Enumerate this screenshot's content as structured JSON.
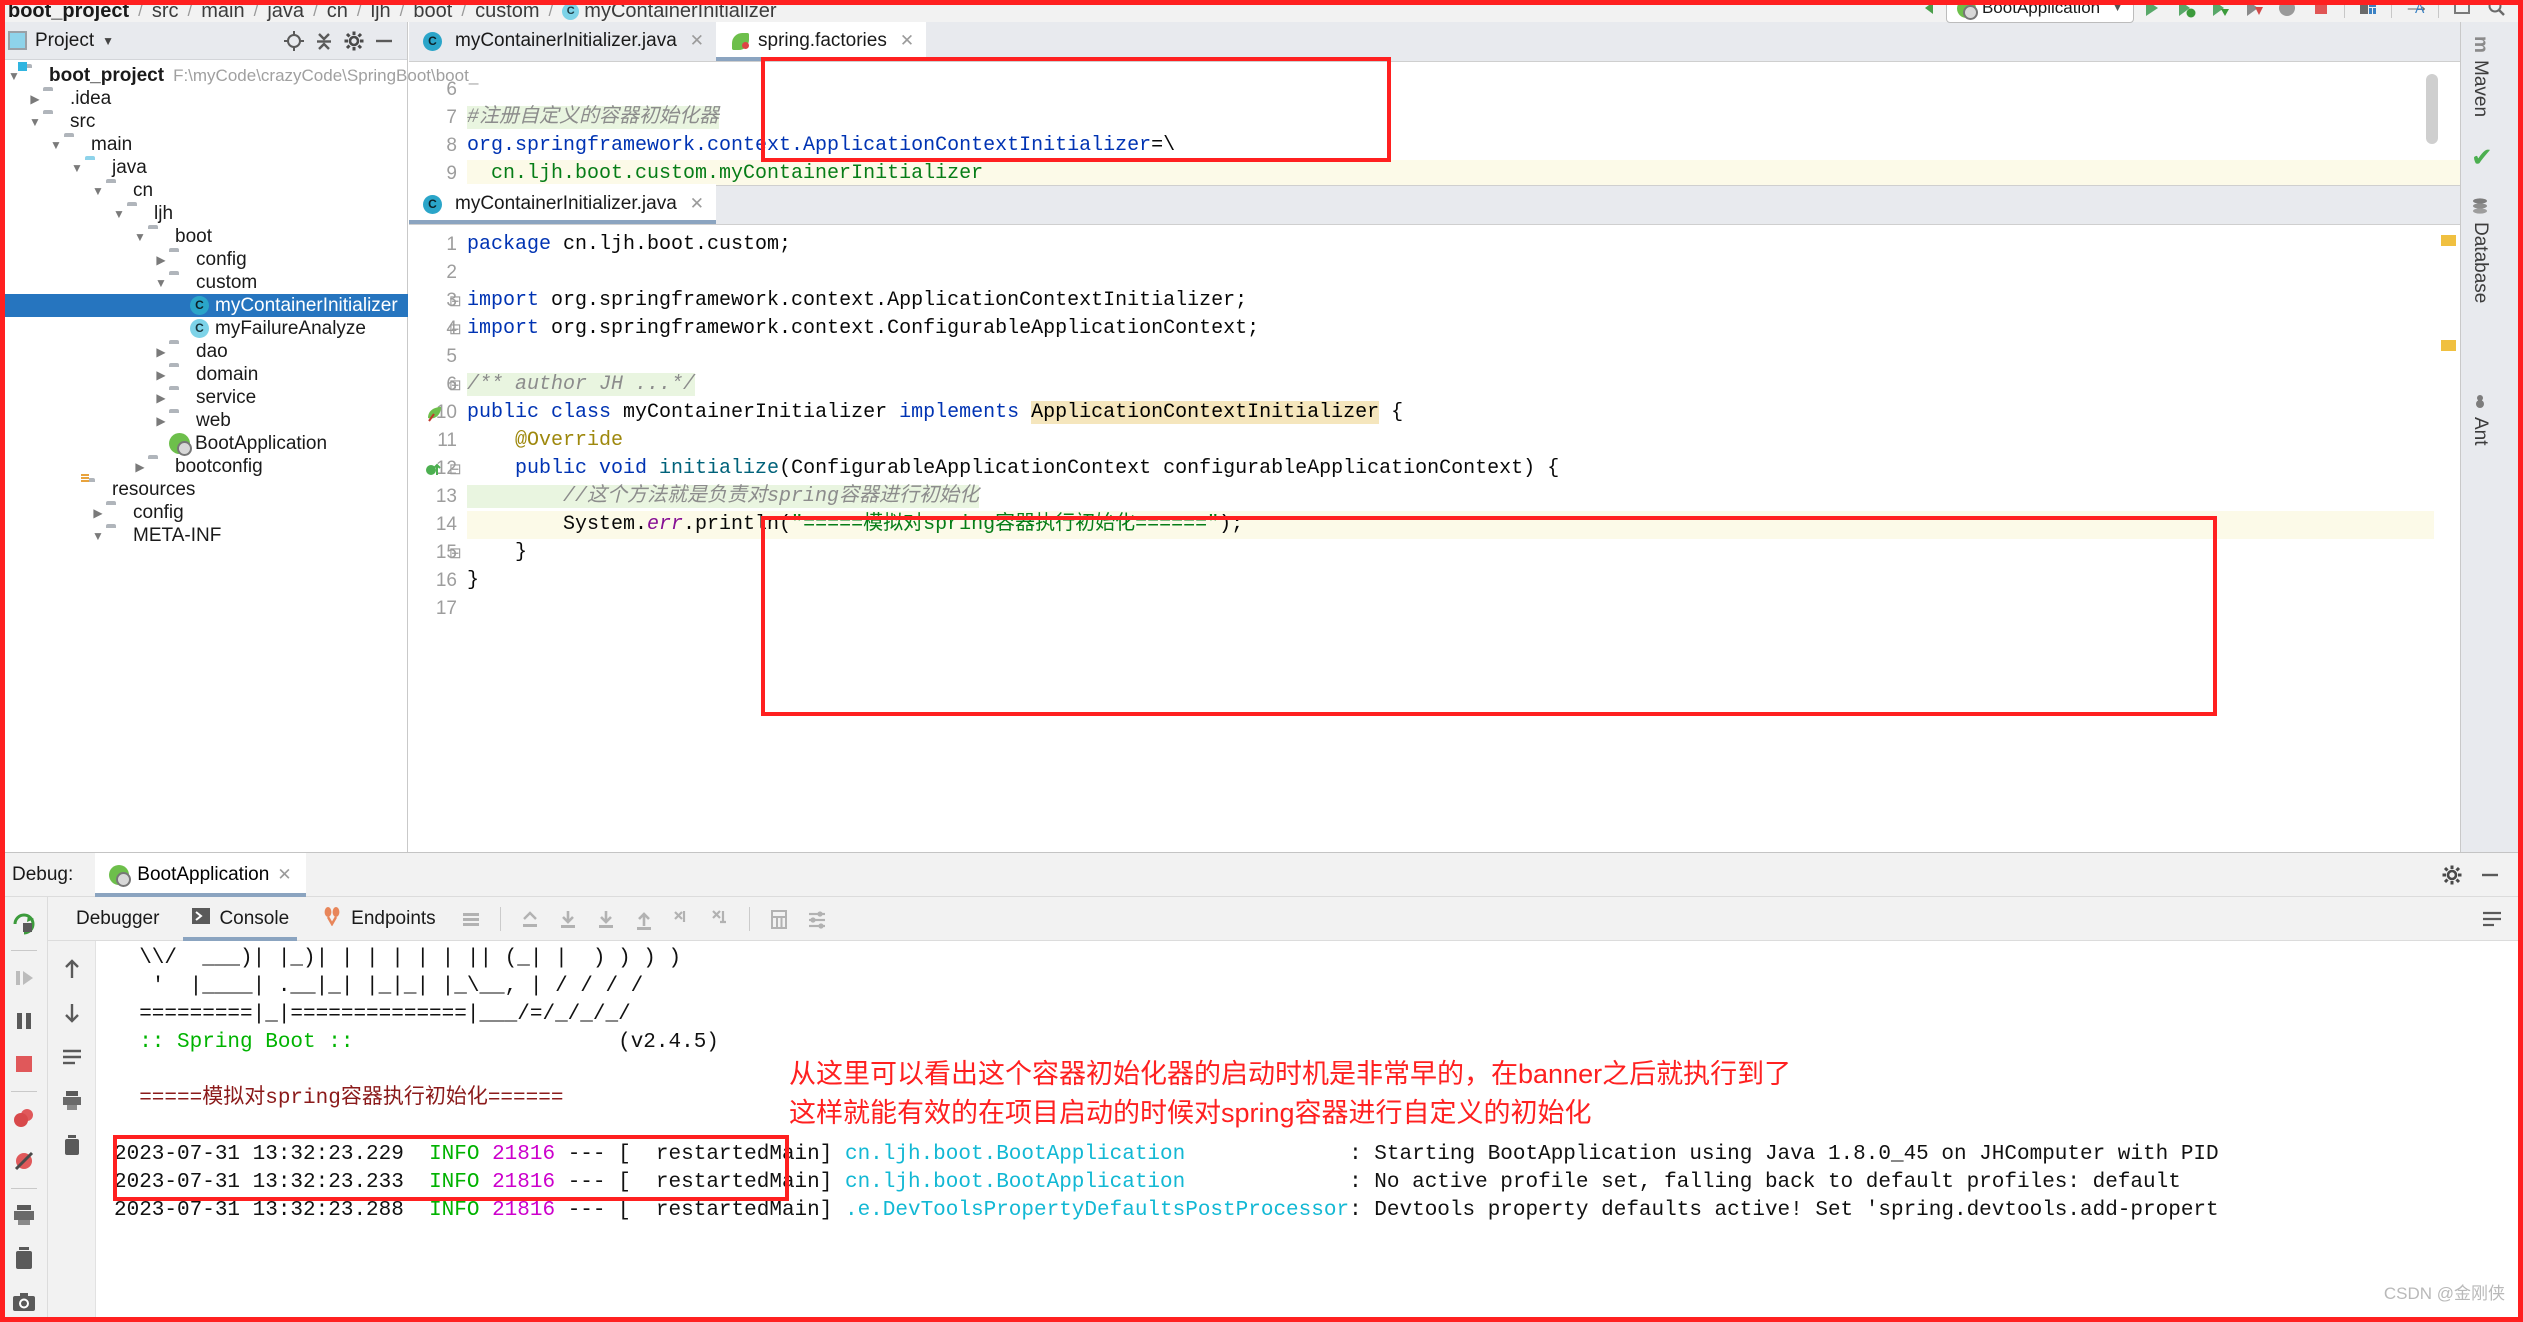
{
  "breadcrumb": {
    "items": [
      "boot_project",
      "src",
      "main",
      "java",
      "cn",
      "ljh",
      "boot",
      "custom",
      "myContainerInitializer"
    ],
    "separator": "/"
  },
  "run_toolbar": {
    "config_name": "BootApplication",
    "icons": [
      "run-icon",
      "debug-icon",
      "run-with-coverage-icon",
      "profile-icon",
      "stop-icon",
      "build-icon",
      "search-everywhere-icon",
      "settings-icon"
    ]
  },
  "project_panel": {
    "title": "Project",
    "header_icons": [
      "locate-icon",
      "collapse-all-icon",
      "settings-gear-icon",
      "hide-icon"
    ],
    "tree": [
      {
        "depth": 0,
        "twisty": "open",
        "icon": "project-folder-icon",
        "label": "boot_project",
        "bold": true,
        "path": "F:\\myCode\\crazyCode\\SpringBoot\\boot_"
      },
      {
        "depth": 1,
        "twisty": "closed",
        "icon": "folder-icon",
        "label": ".idea",
        "bold": false,
        "path": ""
      },
      {
        "depth": 1,
        "twisty": "open",
        "icon": "folder-icon",
        "label": "src",
        "bold": false,
        "path": ""
      },
      {
        "depth": 2,
        "twisty": "open",
        "icon": "folder-icon",
        "label": "main",
        "bold": false,
        "path": ""
      },
      {
        "depth": 3,
        "twisty": "open",
        "icon": "source-folder-icon",
        "label": "java",
        "bold": false,
        "path": ""
      },
      {
        "depth": 4,
        "twisty": "open",
        "icon": "package-icon",
        "label": "cn",
        "bold": false,
        "path": ""
      },
      {
        "depth": 5,
        "twisty": "open",
        "icon": "package-icon",
        "label": "ljh",
        "bold": false,
        "path": ""
      },
      {
        "depth": 6,
        "twisty": "open",
        "icon": "package-icon",
        "label": "boot",
        "bold": false,
        "path": ""
      },
      {
        "depth": 7,
        "twisty": "closed",
        "icon": "package-icon",
        "label": "config",
        "bold": false,
        "path": ""
      },
      {
        "depth": 7,
        "twisty": "open",
        "icon": "package-icon",
        "label": "custom",
        "bold": false,
        "path": ""
      },
      {
        "depth": 8,
        "twisty": "none",
        "icon": "java-class-icon",
        "label": "myContainerInitializer",
        "bold": false,
        "path": "",
        "selected": true
      },
      {
        "depth": 8,
        "twisty": "none",
        "icon": "java-class-icon",
        "label": "myFailureAnalyze",
        "bold": false,
        "path": ""
      },
      {
        "depth": 7,
        "twisty": "closed",
        "icon": "package-icon",
        "label": "dao",
        "bold": false,
        "path": ""
      },
      {
        "depth": 7,
        "twisty": "closed",
        "icon": "package-icon",
        "label": "domain",
        "bold": false,
        "path": ""
      },
      {
        "depth": 7,
        "twisty": "closed",
        "icon": "package-icon",
        "label": "service",
        "bold": false,
        "path": ""
      },
      {
        "depth": 7,
        "twisty": "closed",
        "icon": "package-icon",
        "label": "web",
        "bold": false,
        "path": ""
      },
      {
        "depth": 7,
        "twisty": "none",
        "icon": "spring-boot-class-icon",
        "label": "BootApplication",
        "bold": false,
        "path": ""
      },
      {
        "depth": 6,
        "twisty": "closed",
        "icon": "package-icon",
        "label": "bootconfig",
        "bold": false,
        "path": ""
      },
      {
        "depth": 3,
        "twisty": "none",
        "icon": "resources-folder-icon",
        "label": "resources",
        "bold": false,
        "path": ""
      },
      {
        "depth": 4,
        "twisty": "closed",
        "icon": "folder-icon",
        "label": "config",
        "bold": false,
        "path": ""
      },
      {
        "depth": 4,
        "twisty": "open",
        "icon": "folder-icon",
        "label": "META-INF",
        "bold": false,
        "path": ""
      }
    ]
  },
  "editor_top": {
    "tabs": [
      {
        "label": "myContainerInitializer.java",
        "icon": "java-class-icon",
        "active": false
      },
      {
        "label": "spring.factories",
        "icon": "spring-leaf-icon",
        "active": true
      }
    ],
    "lines": [
      {
        "num": "6",
        "segments": [],
        "current": false
      },
      {
        "num": "7",
        "segments": [
          {
            "t": "#注册自定义的容器初始化器",
            "c": "cmt-hl"
          }
        ],
        "current": false
      },
      {
        "num": "8",
        "segments": [
          {
            "t": "org.springframework.context.ApplicationContextInitializer",
            "c": "propkey"
          },
          {
            "t": "=\\",
            "c": "propsep"
          }
        ],
        "current": false
      },
      {
        "num": "9",
        "segments": [
          {
            "t": "  cn.ljh.boot.custom.myContainerInitializer",
            "c": "propval"
          }
        ],
        "current": true
      }
    ]
  },
  "editor_bottom": {
    "tabs": [
      {
        "label": "myContainerInitializer.java",
        "icon": "java-class-icon",
        "active": true
      }
    ],
    "lines": [
      {
        "num": "1",
        "segments": [
          {
            "t": "package ",
            "c": "kw"
          },
          {
            "t": "cn.ljh.boot.custom;",
            "c": "plain"
          }
        ],
        "current": false,
        "indent": 4
      },
      {
        "num": "2",
        "segments": [],
        "current": false
      },
      {
        "num": "3",
        "segments": [
          {
            "t": "import ",
            "c": "kw"
          },
          {
            "t": "org.springframework.context.ApplicationContextInitializer;",
            "c": "plain"
          }
        ],
        "current": false,
        "fold": "minus"
      },
      {
        "num": "4",
        "segments": [
          {
            "t": "import ",
            "c": "kw"
          },
          {
            "t": "org.springframework.context.ConfigurableApplicationContext;",
            "c": "plain"
          }
        ],
        "current": false,
        "fold": "minus"
      },
      {
        "num": "5",
        "segments": [],
        "current": false
      },
      {
        "num": "6",
        "segments": [
          {
            "t": "/** author JH ...*/",
            "c": "cmt-hl"
          }
        ],
        "current": false,
        "fold": "plus"
      },
      {
        "num": "10",
        "segments": [
          {
            "t": "public class ",
            "c": "kw"
          },
          {
            "t": "myContainerInitializer ",
            "c": "plain"
          },
          {
            "t": "implements ",
            "c": "kw"
          },
          {
            "t": "ApplicationContextInitializer",
            "c": "hlident"
          },
          {
            "t": " {",
            "c": "plain"
          }
        ],
        "current": false,
        "gutter_mark": "spring-bean-icon"
      },
      {
        "num": "11",
        "segments": [
          {
            "t": "    @Override",
            "c": "anno"
          }
        ],
        "current": false
      },
      {
        "num": "12",
        "segments": [
          {
            "t": "    public void ",
            "c": "kw"
          },
          {
            "t": "initialize",
            "c": "fnm"
          },
          {
            "t": "(ConfigurableApplicationContext configurableApplicationContext) {",
            "c": "plain"
          }
        ],
        "current": false,
        "gutter_mark": "override-icon",
        "fold": "minus"
      },
      {
        "num": "13",
        "segments": [
          {
            "t": "        //这个方法就是负责对spring容器进行初始化",
            "c": "cmt-hl"
          }
        ],
        "current": false
      },
      {
        "num": "14",
        "segments": [
          {
            "t": "        System.",
            "c": "plain"
          },
          {
            "t": "err",
            "c": "fld"
          },
          {
            "t": ".println(",
            "c": "plain"
          },
          {
            "t": "\"=====模拟对spring容器执行初始化======\"",
            "c": "str"
          },
          {
            "t": ");",
            "c": "plain"
          }
        ],
        "current": true
      },
      {
        "num": "15",
        "segments": [
          {
            "t": "    }",
            "c": "plain"
          }
        ],
        "current": false,
        "fold": "minus"
      },
      {
        "num": "16",
        "segments": [
          {
            "t": "}",
            "c": "plain"
          }
        ],
        "current": false
      },
      {
        "num": "17",
        "segments": [],
        "current": false
      }
    ]
  },
  "right_strip": {
    "labels": [
      {
        "text": "Maven",
        "icon": "maven-icon"
      },
      {
        "text": "Database",
        "icon": "database-icon"
      },
      {
        "text": "Ant",
        "icon": "ant-icon"
      }
    ]
  },
  "debug": {
    "title_label": "Debug:",
    "session_tab": "BootApplication",
    "settings_icon": "gear-icon",
    "minimize_icon": "minimize-icon",
    "tabs": [
      {
        "label": "Debugger",
        "icon": "",
        "active": false
      },
      {
        "label": "Console",
        "icon": "console-icon",
        "active": true
      },
      {
        "label": "Endpoints",
        "icon": "endpoints-icon",
        "active": false
      }
    ],
    "tab_icons": [
      "layout-icon",
      "step-out-icon",
      "step-over-icon",
      "step-into-icon",
      "force-step-into-icon",
      "run-to-cursor-icon",
      "evaluate-icon",
      "calculator-icon",
      "settings-icon"
    ],
    "right_icons": [
      "soft-wrap-icon"
    ],
    "left_toolbar_icons": [
      "rerun-icon",
      "resume-icon",
      "pause-icon",
      "stop-icon",
      "view-breakpoints-icon",
      "mute-breakpoints-icon",
      "print-icon",
      "trash-icon",
      "screenshot-icon"
    ],
    "console_strip_icons": [
      "scroll-up-icon",
      "scroll-down-icon",
      "soft-wrap-icon",
      "print-icon",
      "trash-icon"
    ]
  },
  "console": {
    "banner": [
      "  \\\\/  ___)| |_)| | | | | | || (_| |  ) ) ) )",
      "   '  |____| .__|_| |_|_| |_\\__, | / / / /",
      "  =========|_|==============|___/=/_/_/_/"
    ],
    "banner_title": ":: Spring Boot ::",
    "banner_version": "(v2.4.5)",
    "highlight_output": "=====模拟对spring容器执行初始化======",
    "log_lines": [
      {
        "date": "2023-07-31 13:32:23.229",
        "level": "INFO",
        "pid": "21816",
        "sep": "--- [",
        "thread": "  restartedMain]",
        "logger": "cn.ljh.boot.BootApplication",
        "colon": ":",
        "message": "Starting BootApplication using Java 1.8.0_45 on JHComputer with PID"
      },
      {
        "date": "2023-07-31 13:32:23.233",
        "level": "INFO",
        "pid": "21816",
        "sep": "--- [",
        "thread": "  restartedMain]",
        "logger": "cn.ljh.boot.BootApplication",
        "colon": ":",
        "message": "No active profile set, falling back to default profiles: default"
      },
      {
        "date": "2023-07-31 13:32:23.288",
        "level": "INFO",
        "pid": "21816",
        "sep": "--- [",
        "thread": "  restartedMain]",
        "logger": ".e.DevToolsPropertyDefaultsPostProcessor",
        "colon": ":",
        "message": "Devtools property defaults active! Set 'spring.devtools.add-propert"
      }
    ]
  },
  "annotations": {
    "note_line1": "从这里可以看出这个容器初始化器的启动时机是非常早的，在banner之后就执行到了",
    "note_line2": "这样就能有效的在项目启动的时候对spring容器进行自定义的初始化",
    "watermark": "CSDN @金刚侠",
    "highlight_color": "#ff2020"
  }
}
